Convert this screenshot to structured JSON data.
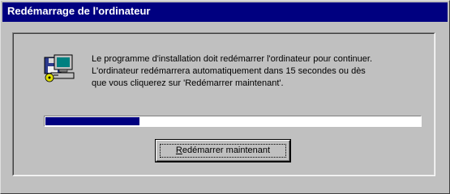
{
  "window": {
    "title": "Redémarrage de l'ordinateur"
  },
  "message": {
    "line1": "Le programme d'installation doit redémarrer l'ordinateur pour continuer.",
    "line2": "L'ordinateur redémarrera automatiquement dans 15 secondes ou dès",
    "line3": "que vous cliquerez sur 'Redémarrer maintenant'."
  },
  "progress": {
    "percent": 25
  },
  "buttons": {
    "restart_now": {
      "mnemonic": "R",
      "rest": "edémarrer maintenant"
    }
  },
  "icons": {
    "setup": "computer-setup-icon"
  },
  "colors": {
    "titlebar": "#000080",
    "progress_fill": "#000080",
    "face": "#c0c0c0"
  }
}
